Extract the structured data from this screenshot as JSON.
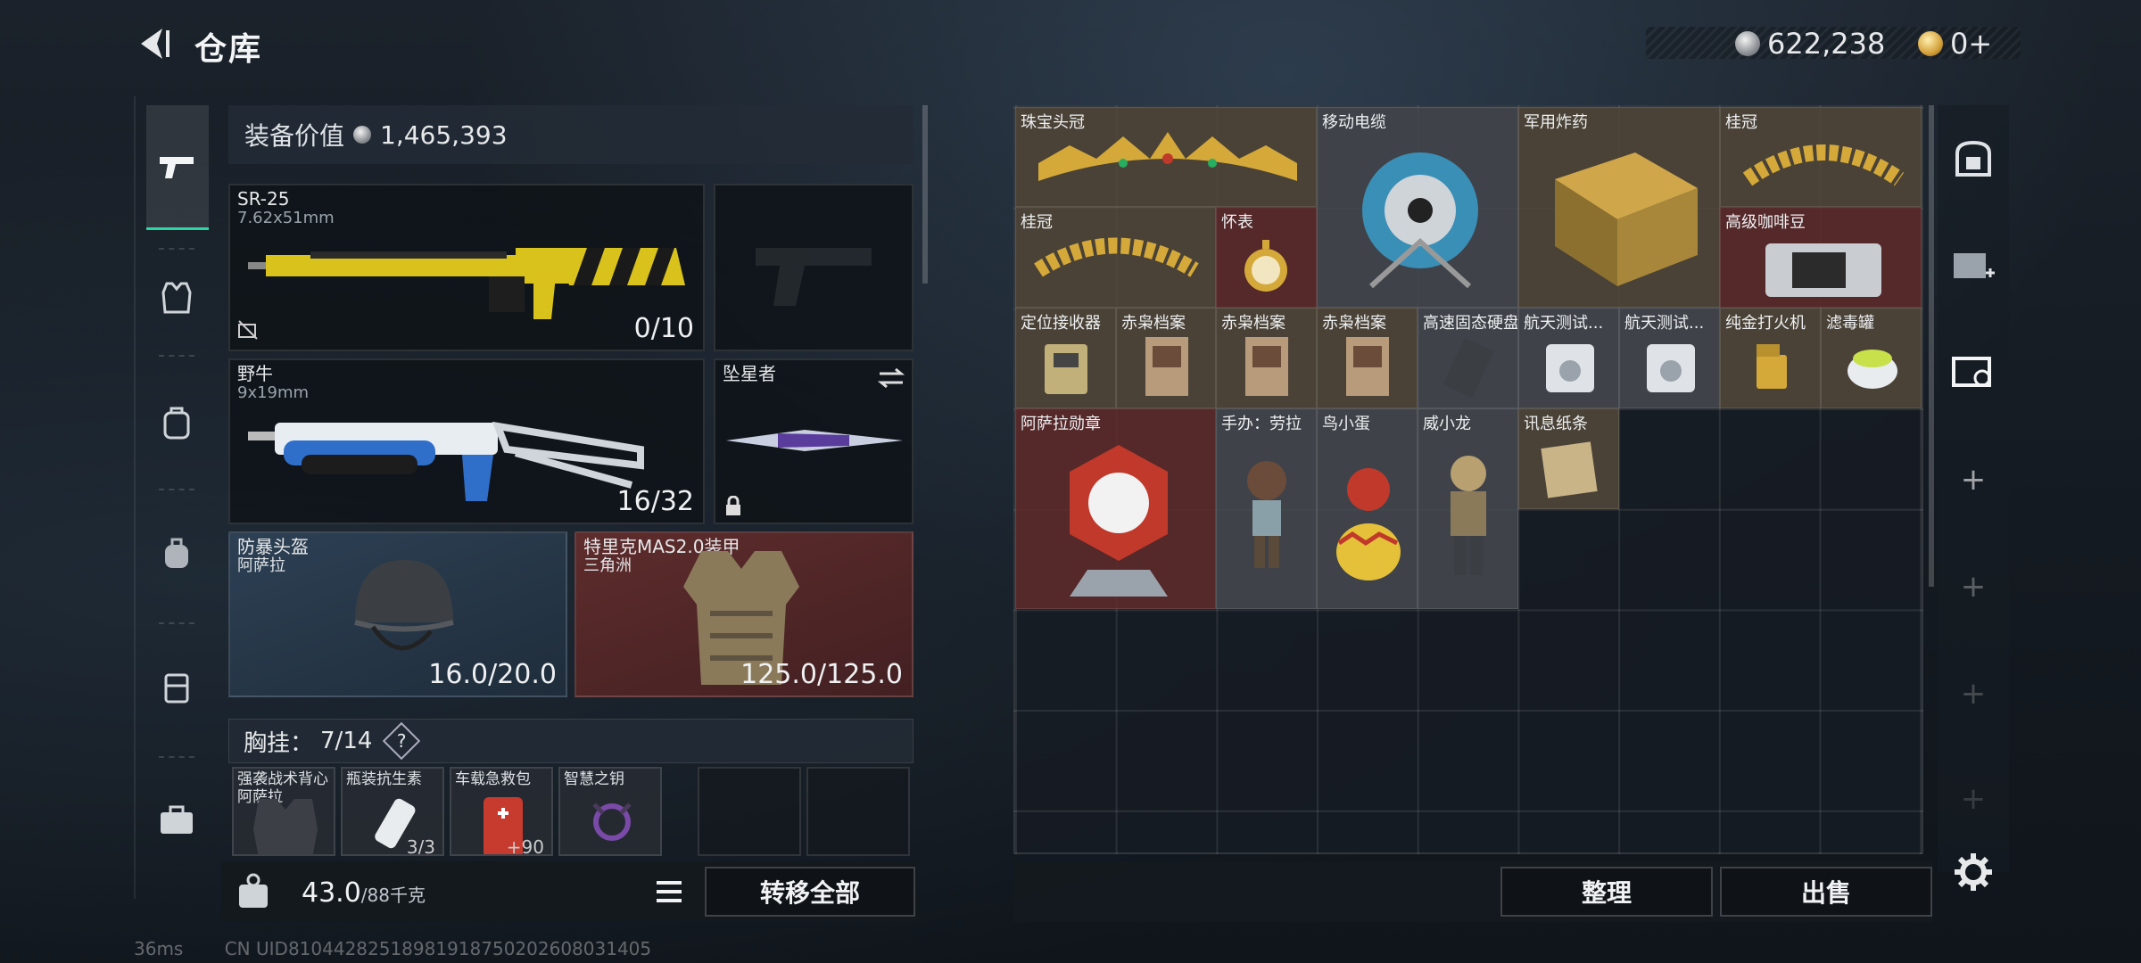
{
  "header": {
    "title": "仓库",
    "currency_silver": "622,238",
    "currency_gold": "0+"
  },
  "equipment": {
    "value_label": "装备价值",
    "value": "1,465,393",
    "primary": {
      "name": "SR-25",
      "ammo": "7.62x51mm",
      "count": "0/10"
    },
    "secondary": {
      "name": "野牛",
      "ammo": "9x19mm",
      "count": "16/32"
    },
    "melee": {
      "name": "坠星者"
    },
    "helmet": {
      "name": "防暴头盔",
      "sub": "阿萨拉",
      "durability": "16.0/20.0"
    },
    "armor": {
      "name": "特里克MAS2.0装甲",
      "sub": "三角洲",
      "durability": "125.0/125.0"
    },
    "chest_rig": {
      "label": "胸挂：",
      "capacity": "7/14",
      "help": "?"
    },
    "rig_items": [
      {
        "name": "强袭战术背心",
        "sub": "阿萨拉",
        "count": ""
      },
      {
        "name": "瓶装抗生素",
        "sub": "",
        "count": "3/3"
      },
      {
        "name": "车载急救包",
        "sub": "",
        "count": "+90"
      },
      {
        "name": "智慧之钥",
        "sub": "",
        "count": ""
      },
      {
        "name": "",
        "sub": "",
        "count": ""
      },
      {
        "name": "",
        "sub": "",
        "count": ""
      }
    ],
    "weight": "43.0",
    "weight_max": "/88千克",
    "transfer_all": "转移全部"
  },
  "storage": {
    "items": [
      {
        "name": "珠宝头冠"
      },
      {
        "name": "移动电缆"
      },
      {
        "name": "军用炸药"
      },
      {
        "name": "桂冠"
      },
      {
        "name": "桂冠"
      },
      {
        "name": "怀表"
      },
      {
        "name": "高级咖啡豆"
      },
      {
        "name": "定位接收器"
      },
      {
        "name": "赤枭档案"
      },
      {
        "name": "赤枭档案"
      },
      {
        "name": "赤枭档案"
      },
      {
        "name": "高速固态硬盘"
      },
      {
        "name": "航天测试..."
      },
      {
        "name": "航天测试..."
      },
      {
        "name": "纯金打火机"
      },
      {
        "name": "滤毒罐"
      },
      {
        "name": "阿萨拉勋章"
      },
      {
        "name": "手办：劳拉"
      },
      {
        "name": "鸟小蛋"
      },
      {
        "name": "威小龙"
      },
      {
        "name": "讯息纸条"
      }
    ],
    "sort_label": "整理",
    "sell_label": "出售"
  },
  "status": {
    "ping": "36ms",
    "uid": "CN UID8104428251898191875020260803140​5"
  },
  "colors": {
    "accent": "#2dd6a5",
    "gold_slot": "#544a3a",
    "red_slot": "#602a2c"
  }
}
